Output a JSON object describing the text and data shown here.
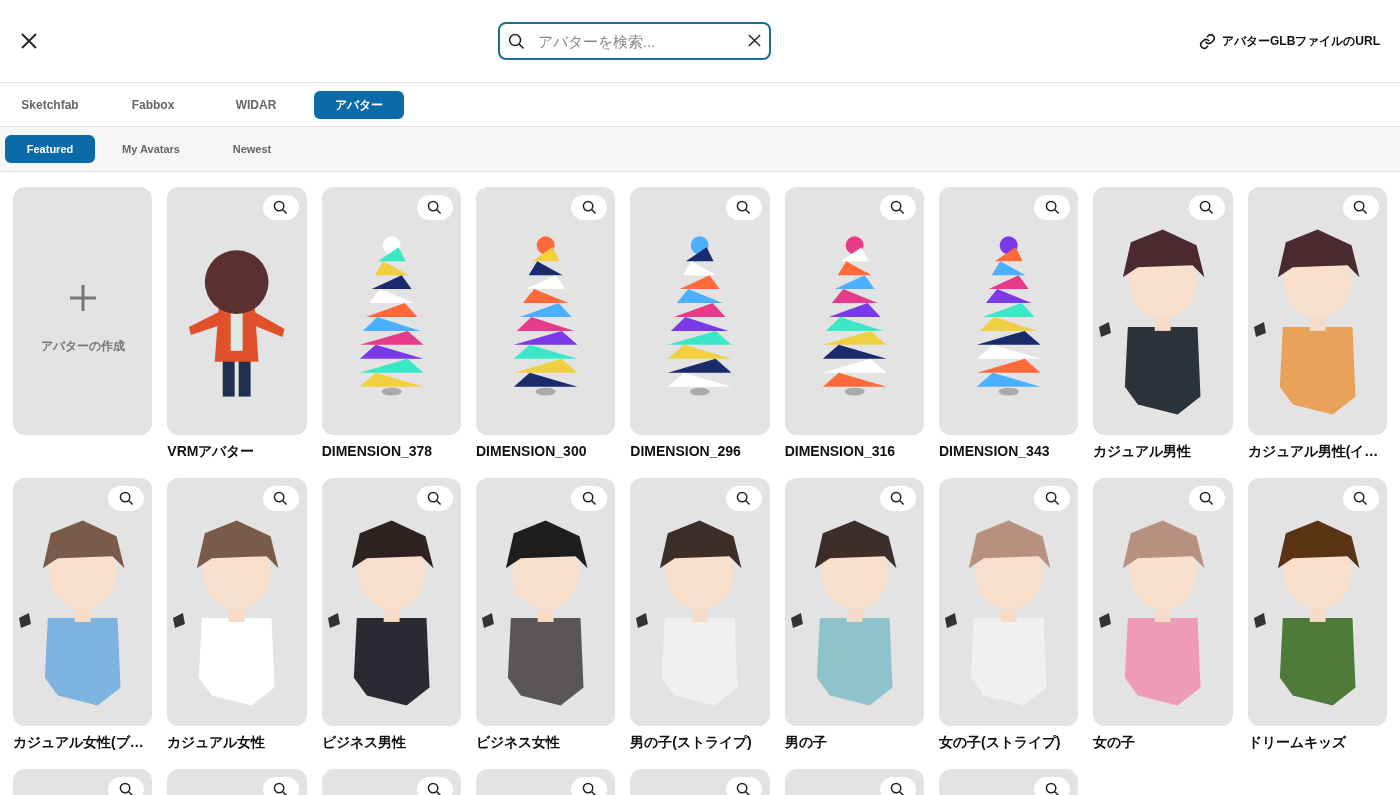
{
  "header": {
    "search": {
      "placeholder": "アバターを検索..."
    },
    "link": "アバターGLBファイルのURL"
  },
  "source_tabs": [
    {
      "label": "Sketchfab",
      "selected": false
    },
    {
      "label": "Fabbox",
      "selected": false
    },
    {
      "label": "WIDAR",
      "selected": false
    },
    {
      "label": "アバター",
      "selected": true
    }
  ],
  "filter_tabs": [
    {
      "label": "Featured",
      "selected": true
    },
    {
      "label": "My Avatars",
      "selected": false
    },
    {
      "label": "Newest",
      "selected": false
    }
  ],
  "cards": [
    {
      "kind": "create",
      "label": "アバターの作成"
    },
    {
      "kind": "avatar",
      "name": "VRMアバター"
    },
    {
      "kind": "avatar",
      "name": "DIMENSION_378"
    },
    {
      "kind": "avatar",
      "name": "DIMENSION_300"
    },
    {
      "kind": "avatar",
      "name": "DIMENSION_296"
    },
    {
      "kind": "avatar",
      "name": "DIMENSION_316"
    },
    {
      "kind": "avatar",
      "name": "DIMENSION_343"
    },
    {
      "kind": "avatar",
      "name": "カジュアル男性"
    },
    {
      "kind": "avatar",
      "name": "カジュアル男性(イ…"
    },
    {
      "kind": "avatar",
      "name": "カジュアル女性(ブ…"
    },
    {
      "kind": "avatar",
      "name": "カジュアル女性"
    },
    {
      "kind": "avatar",
      "name": "ビジネス男性"
    },
    {
      "kind": "avatar",
      "name": "ビジネス女性"
    },
    {
      "kind": "avatar",
      "name": "男の子(ストライプ)"
    },
    {
      "kind": "avatar",
      "name": "男の子"
    },
    {
      "kind": "avatar",
      "name": "女の子(ストライプ)"
    },
    {
      "kind": "avatar",
      "name": "女の子"
    },
    {
      "kind": "avatar",
      "name": "ドリームキッズ"
    },
    {
      "kind": "avatar"
    },
    {
      "kind": "avatar"
    },
    {
      "kind": "avatar"
    },
    {
      "kind": "avatar"
    },
    {
      "kind": "avatar"
    },
    {
      "kind": "avatar"
    },
    {
      "kind": "avatar"
    }
  ]
}
